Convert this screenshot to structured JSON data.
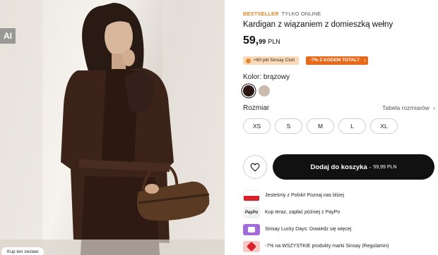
{
  "photo": {
    "ai_badge": "AI",
    "shop_look_label": "Kup ten zestaw"
  },
  "product": {
    "tag_bestseller": "BESTSELLER",
    "tag_online": "TYLKO ONLINE",
    "title": "Kardigan z wiązaniem z domieszką wełny",
    "price_main": "59,",
    "price_decimal": "99",
    "price_currency": "PLN"
  },
  "badges": {
    "club": "+60 pkt Sinsay Club",
    "promo": "-7% Z KODEM TOTAL7"
  },
  "color": {
    "label": "Kolor: brązowy",
    "swatches": [
      "#2c1811",
      "#c9bcae"
    ],
    "selected_index": 0
  },
  "size": {
    "label": "Rozmiar",
    "chart_link": "Tabela rozmiarów",
    "options": [
      "XS",
      "S",
      "M",
      "L",
      "XL"
    ]
  },
  "cart": {
    "label": "Dodaj do koszyka",
    "separator": "-",
    "price": "59,99 PLN"
  },
  "perks": [
    {
      "icon": "polish-flag-icon",
      "text": "Jesteśmy z Polski! Poznaj nas bliżej"
    },
    {
      "icon": "paypo-icon",
      "text": "Kup teraz, zapłać później z PayPo",
      "badge": "PayPo"
    },
    {
      "icon": "lucky-days-icon",
      "text": "Sinsay Lucky Days: Dowiedz się więcej"
    },
    {
      "icon": "promo-tag-icon",
      "text": "-7% na WSZYSTKIE produkty marki Sinsay (Regulamin)"
    }
  ],
  "colors": {
    "accent_orange": "#e58a2c",
    "promo_orange": "#e96a1b",
    "cart_black": "#111111",
    "product_brown": "#3b2319"
  }
}
